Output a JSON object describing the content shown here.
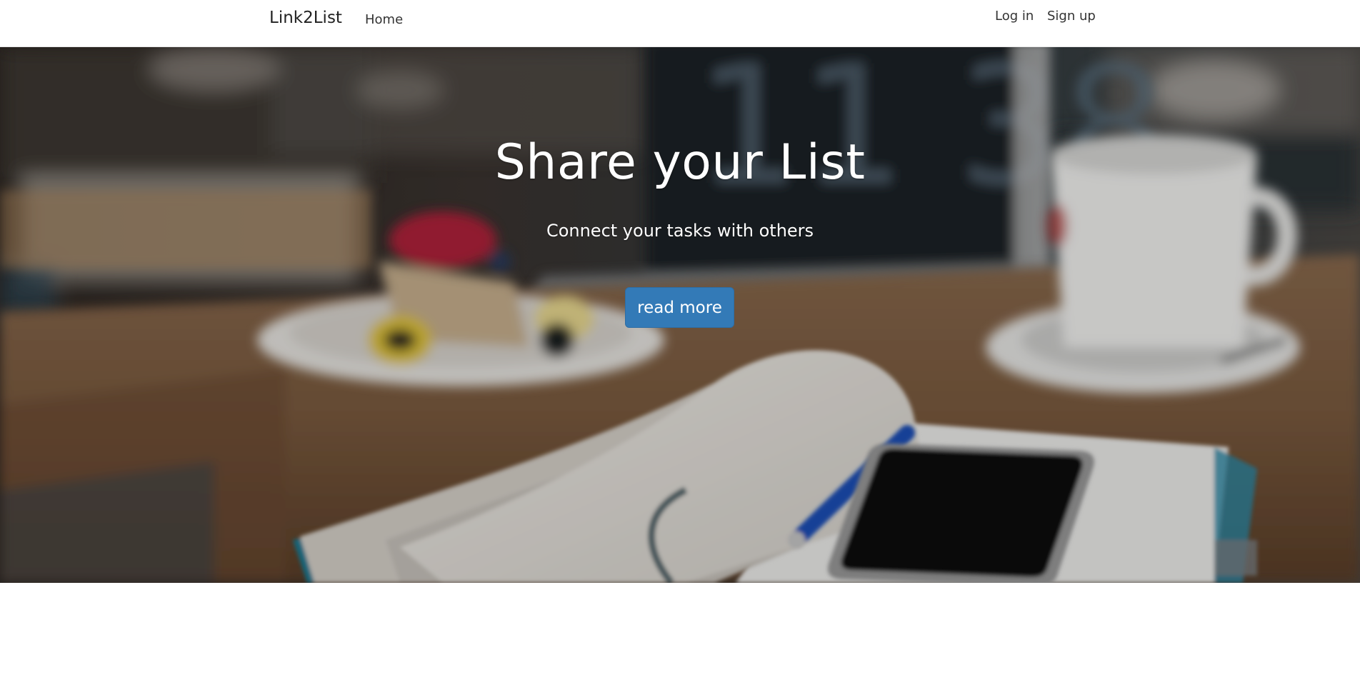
{
  "navbar": {
    "brand": "Link2List",
    "home_label": "Home",
    "login_label": "Log in",
    "signup_label": "Sign up"
  },
  "hero": {
    "title": "Share your List",
    "subtitle": "Connect your tasks with others",
    "button_label": "read more",
    "button_color": "#337ab7"
  }
}
